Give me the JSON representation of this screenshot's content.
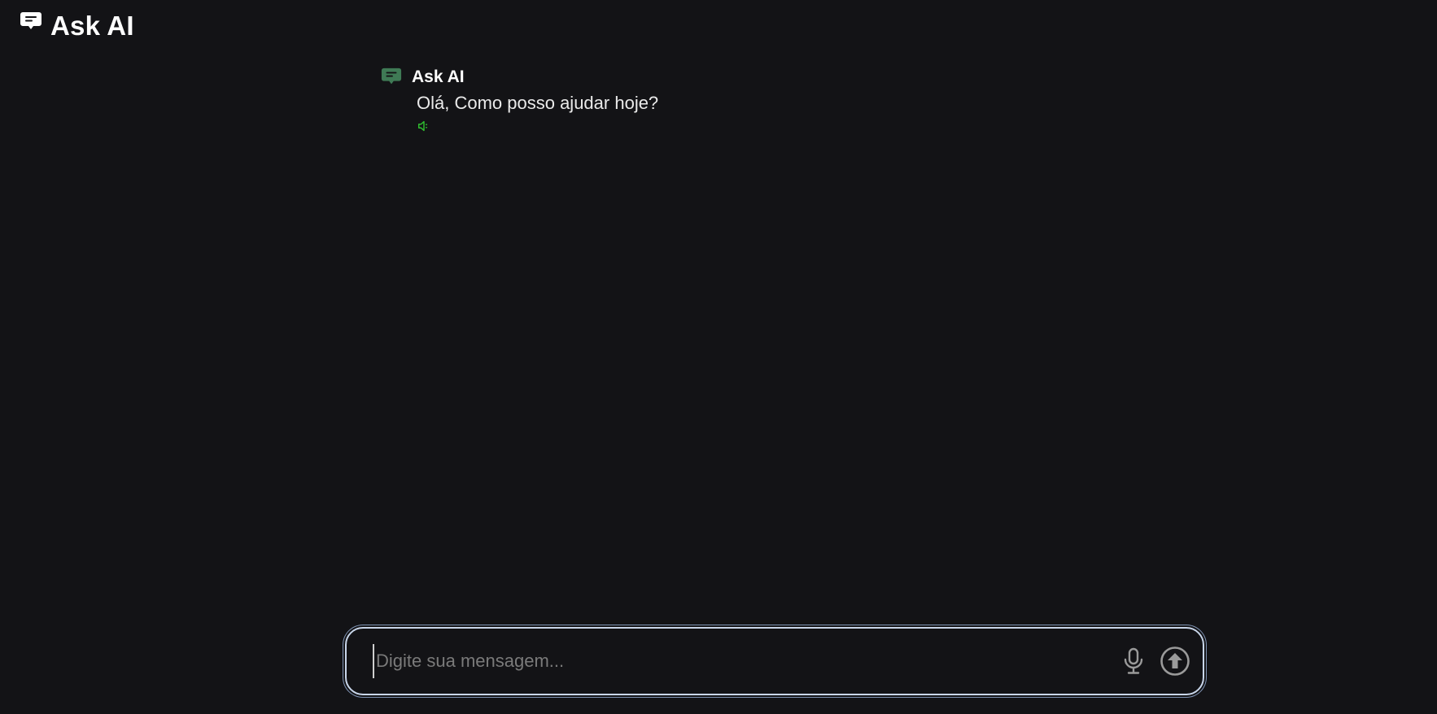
{
  "header": {
    "title": "Ask AI",
    "icon": "chat-bubble-icon"
  },
  "conversation": {
    "messages": [
      {
        "sender": "Ask AI",
        "text": "Olá, Como posso ajudar hoje?",
        "avatar_icon": "chat-bubble-icon",
        "avatar_color": "#3f7a55",
        "action_icon": "speaker-icon",
        "action_color": "#2fbf2f"
      }
    ]
  },
  "composer": {
    "placeholder": "Digite sua mensagem...",
    "value": "",
    "mic_icon": "microphone-icon",
    "send_icon": "arrow-up-circle-icon",
    "border_color": "#c9d6ea"
  },
  "colors": {
    "background": "#131316",
    "text": "#ffffff",
    "icon_gray": "#9a9a9a"
  }
}
